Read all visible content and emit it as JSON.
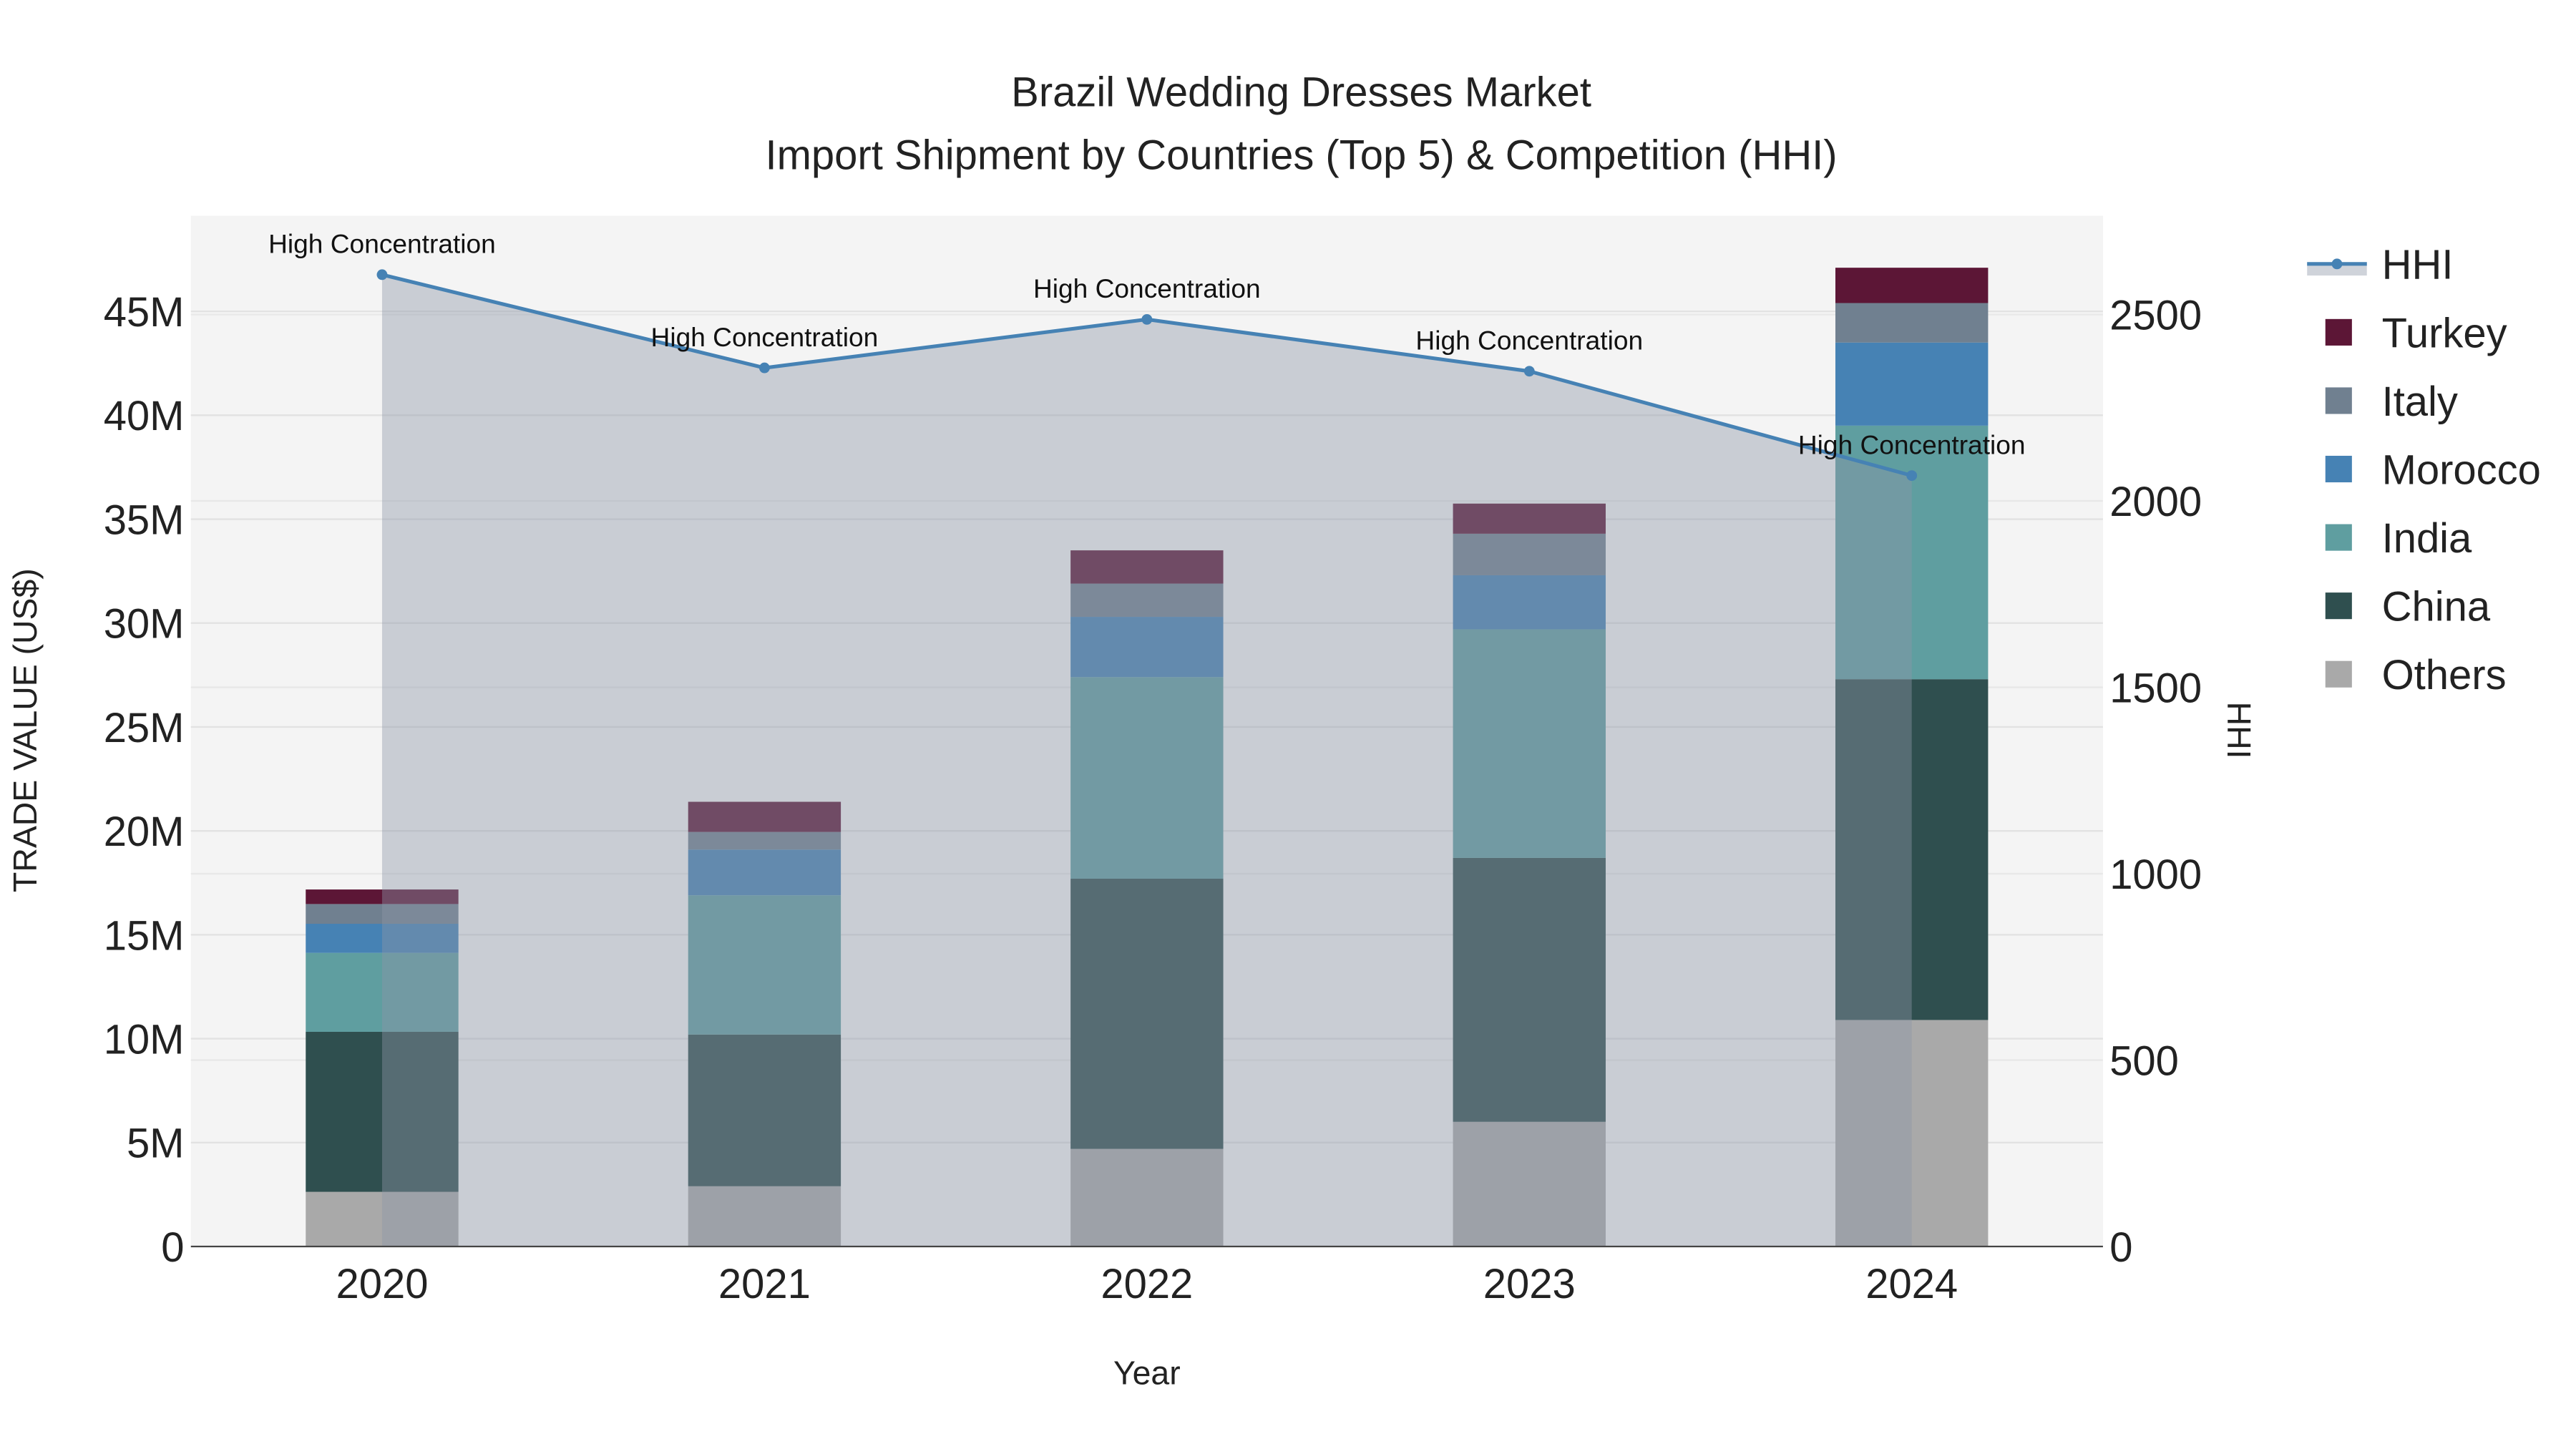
{
  "chart_data": {
    "type": "bar",
    "title": "Brazil Wedding Dresses Market",
    "subtitle": "Import Shipment by Countries (Top 5) & Competition (HHI)",
    "xlabel": "Year",
    "ylabel": "TRADE VALUE (US$)",
    "y2label": "HHI",
    "categories": [
      "2020",
      "2021",
      "2022",
      "2023",
      "2024"
    ],
    "ylim": [
      0,
      49600000
    ],
    "y2lim": [
      0,
      2765
    ],
    "yticks": [
      {
        "value": 0,
        "label": "0"
      },
      {
        "value": 5000000,
        "label": "5M"
      },
      {
        "value": 10000000,
        "label": "10M"
      },
      {
        "value": 15000000,
        "label": "15M"
      },
      {
        "value": 20000000,
        "label": "20M"
      },
      {
        "value": 25000000,
        "label": "25M"
      },
      {
        "value": 30000000,
        "label": "30M"
      },
      {
        "value": 35000000,
        "label": "35M"
      },
      {
        "value": 40000000,
        "label": "40M"
      },
      {
        "value": 45000000,
        "label": "45M"
      }
    ],
    "y2ticks": [
      {
        "value": 0,
        "label": "0"
      },
      {
        "value": 500,
        "label": "500"
      },
      {
        "value": 1000,
        "label": "1000"
      },
      {
        "value": 1500,
        "label": "1500"
      },
      {
        "value": 2000,
        "label": "2000"
      },
      {
        "value": 2500,
        "label": "2500"
      }
    ],
    "grid": true,
    "legend_placement": "right",
    "stacked": true,
    "series": [
      {
        "name": "Others",
        "color": "#a9a9a9",
        "values": [
          2630000,
          2900000,
          4700000,
          6000000,
          10900000
        ]
      },
      {
        "name": "China",
        "color": "#2f4f4f",
        "values": [
          7700000,
          7300000,
          13000000,
          12700000,
          16400000
        ]
      },
      {
        "name": "India",
        "color": "#5f9ea0",
        "values": [
          3800000,
          6700000,
          9700000,
          11000000,
          12200000
        ]
      },
      {
        "name": "Morocco",
        "color": "#4682b4",
        "values": [
          1400000,
          2200000,
          2900000,
          2600000,
          4000000
        ]
      },
      {
        "name": "Italy",
        "color": "#708090",
        "values": [
          950000,
          850000,
          1600000,
          2000000,
          1900000
        ]
      },
      {
        "name": "Turkey",
        "color": "#5c1636",
        "values": [
          700000,
          1450000,
          1600000,
          1450000,
          1700000
        ]
      }
    ],
    "hhi": {
      "name": "HHI",
      "color": "#4682b4",
      "values": [
        2607,
        2357,
        2487,
        2348,
        2068
      ],
      "annotations": [
        "High Concentration",
        "High Concentration",
        "High Concentration",
        "High Concentration",
        "High Concentration"
      ]
    },
    "legend_order": [
      "HHI",
      "Turkey",
      "Italy",
      "Morocco",
      "India",
      "China",
      "Others"
    ]
  }
}
